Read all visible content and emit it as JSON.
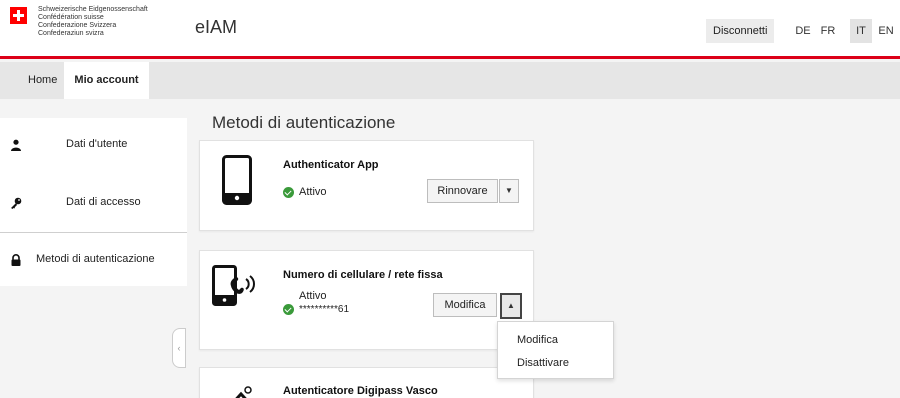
{
  "header": {
    "confederation": [
      "Schweizerische Eidgenossenschaft",
      "Confédération suisse",
      "Confederazione Svizzera",
      "Confederaziun svizra"
    ],
    "app_title": "eIAM",
    "logout_label": "Disconnetti",
    "languages": [
      "DE",
      "FR",
      "IT",
      "EN"
    ],
    "active_language": "IT"
  },
  "nav": {
    "items": [
      {
        "label": "Home"
      },
      {
        "label": "Mio account"
      }
    ],
    "active": "Mio account"
  },
  "sidebar": {
    "items": [
      {
        "label": "Dati d'utente",
        "icon": "user-icon"
      },
      {
        "label": "Dati di accesso",
        "icon": "key-icon"
      },
      {
        "label": "Metodi di autenticazione",
        "icon": "lock-icon"
      }
    ],
    "active": "Metodi di autenticazione"
  },
  "main": {
    "title": "Metodi di autenticazione",
    "cards": [
      {
        "title": "Authenticator App",
        "icon": "smartphone-icon",
        "status": "Attivo",
        "action_label": "Rinnovare"
      },
      {
        "title": "Numero di cellulare / rete fissa",
        "icon": "phone-call-icon",
        "status": "Attivo",
        "masked_number": "**********61",
        "action_label": "Modifica"
      },
      {
        "title": "Autenticatore Digipass Vasco",
        "icon": "token-icon"
      }
    ],
    "dropdown": {
      "items": [
        "Modifica",
        "Disattivare"
      ]
    }
  },
  "colors": {
    "brand_red": "#dc0018",
    "status_green": "#3a9a3a"
  }
}
